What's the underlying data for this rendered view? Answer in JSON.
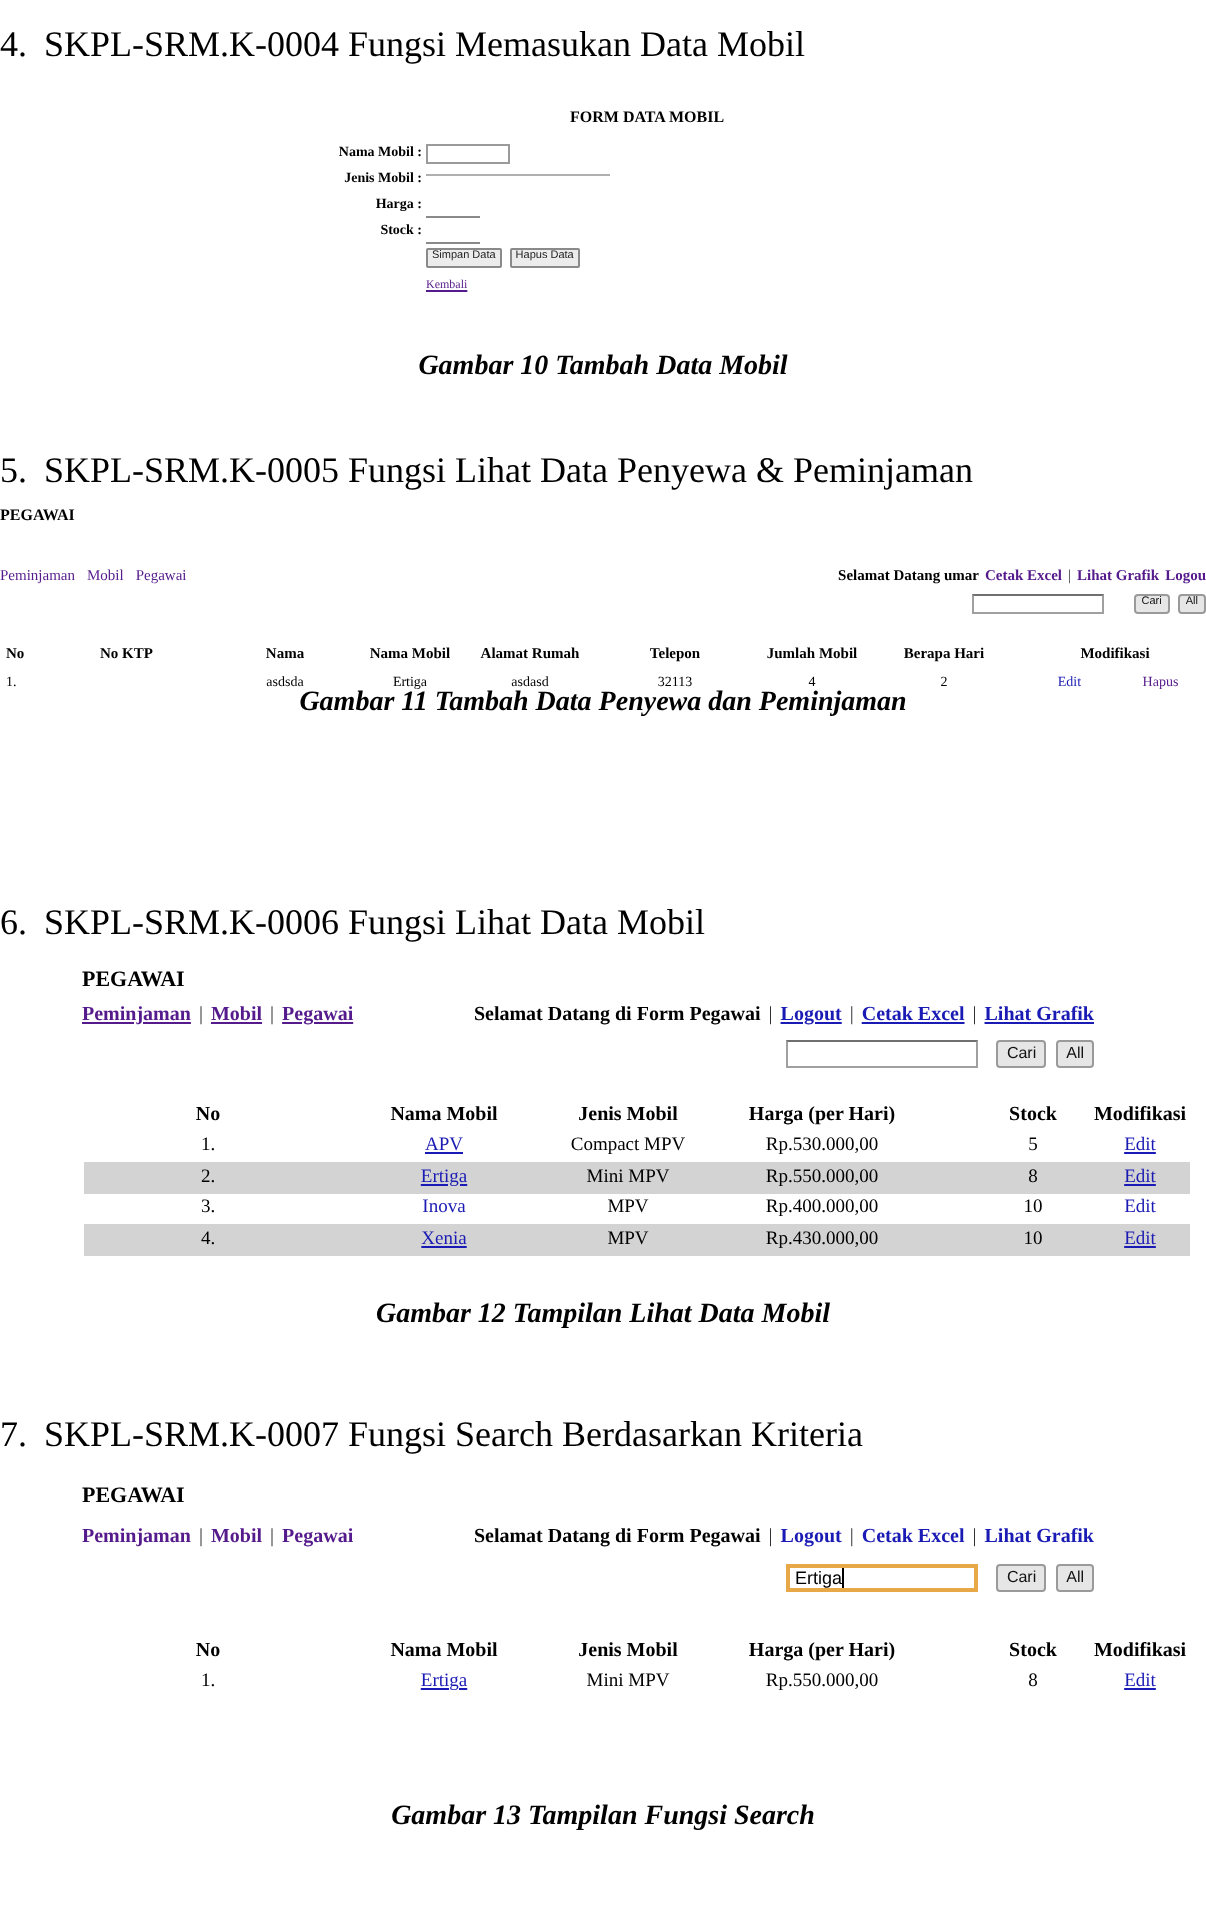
{
  "sections": [
    {
      "number": "4.",
      "title": "SKPL-SRM.K-0004 Fungsi Memasukan Data Mobil",
      "figure": {
        "kind": "form",
        "title": "FORM DATA MOBIL",
        "fields": [
          {
            "label": "Nama Mobil :",
            "kind": "box"
          },
          {
            "label": "Jenis Mobil :",
            "kind": "wide_line"
          },
          {
            "label": "Harga :",
            "kind": "short_line"
          },
          {
            "label": "Stock :",
            "kind": "short_line"
          }
        ],
        "buttons": [
          "Simpan Data",
          "Hapus Data"
        ],
        "link": {
          "text": "Kembali",
          "visited": true,
          "underlined": true
        }
      },
      "caption": "Gambar 10 Tambah Data Mobil"
    },
    {
      "number": "5.",
      "title": "SKPL-SRM.K-0005 Fungsi Lihat Data Penyewa & Peminjaman",
      "figure": {
        "kind": "listing",
        "title": "PEGAWAI",
        "nav": [
          {
            "kind": "link",
            "text": "Peminjaman",
            "visited": true,
            "underlined": false
          },
          {
            "kind": "link",
            "text": "Mobil",
            "visited": true,
            "underlined": false
          },
          {
            "kind": "link",
            "text": "Pegawai",
            "visited": true,
            "underlined": false
          }
        ],
        "header": [
          {
            "kind": "text",
            "text": "Selamat Datang umar"
          },
          {
            "kind": "link",
            "text": "Cetak Excel",
            "visited": true,
            "underlined": false
          },
          {
            "kind": "separator",
            "text": "|"
          },
          {
            "kind": "link",
            "text": "Lihat Grafik",
            "visited": true,
            "underlined": false
          },
          {
            "kind": "link",
            "text": "Logou",
            "visited": true,
            "underlined": false
          }
        ],
        "search": {
          "focused": false
        },
        "search_buttons": [
          "Cari",
          "All"
        ],
        "table": {
          "columns": [
            "No",
            "No KTP",
            "Nama",
            "Nama Mobil",
            "Alamat Rumah",
            "Telepon",
            "Jumlah Mobil",
            "Berapa Hari",
            "Modifikasi"
          ],
          "rows": [
            {
              "cells": [
                {
                  "kind": "text",
                  "text": "1."
                },
                {
                  "kind": "blank"
                },
                {
                  "kind": "text",
                  "text": "asdsda"
                },
                {
                  "kind": "text",
                  "text": "Ertiga"
                },
                {
                  "kind": "text",
                  "text": "asdasd"
                },
                {
                  "kind": "text",
                  "text": "32113"
                },
                {
                  "kind": "text",
                  "text": "4"
                },
                {
                  "kind": "text",
                  "text": "2"
                },
                {
                  "kind": "links",
                  "links": [
                    {
                      "text": "Edit",
                      "visited": false,
                      "underlined": false
                    },
                    {
                      "text": "Hapus",
                      "visited": true,
                      "underlined": false
                    }
                  ]
                }
              ]
            }
          ]
        }
      },
      "caption": "Gambar 11 Tambah Data Penyewa dan Peminjaman"
    },
    {
      "number": "6.",
      "title": "SKPL-SRM.K-0006 Fungsi Lihat Data Mobil",
      "figure": {
        "kind": "listing",
        "title": "PEGAWAI",
        "nav": [
          {
            "kind": "link",
            "text": "Peminjaman",
            "visited": true,
            "underlined": true
          },
          {
            "kind": "separator",
            "text": "|"
          },
          {
            "kind": "link",
            "text": "Mobil",
            "visited": true,
            "underlined": true
          },
          {
            "kind": "separator",
            "text": "|"
          },
          {
            "kind": "link",
            "text": "Pegawai",
            "visited": true,
            "underlined": true
          }
        ],
        "header": [
          {
            "kind": "text",
            "text": "Selamat Datang di Form Pegawai"
          },
          {
            "kind": "separator",
            "text": "|"
          },
          {
            "kind": "link",
            "text": "Logout",
            "visited": false,
            "underlined": true
          },
          {
            "kind": "separator",
            "text": "|"
          },
          {
            "kind": "link",
            "text": "Cetak Excel",
            "visited": false,
            "underlined": true
          },
          {
            "kind": "separator",
            "text": "|"
          },
          {
            "kind": "link",
            "text": "Lihat Grafik",
            "visited": false,
            "underlined": true
          }
        ],
        "search": {
          "focused": false
        },
        "search_buttons": [
          "Cari",
          "All"
        ],
        "table": {
          "columns": [
            "No",
            "Nama Mobil",
            "Jenis Mobil",
            "Harga (per Hari)",
            "Stock",
            "Modifikasi"
          ],
          "rows": [
            {
              "shaded": false,
              "cells": [
                {
                  "kind": "text",
                  "text": "1."
                },
                {
                  "kind": "link",
                  "text": "APV",
                  "visited": false,
                  "underlined": true
                },
                {
                  "kind": "text",
                  "text": "Compact MPV"
                },
                {
                  "kind": "text",
                  "text": "Rp.530.000,00"
                },
                {
                  "kind": "text",
                  "text": "5"
                },
                {
                  "kind": "link",
                  "text": "Edit",
                  "visited": false,
                  "underlined": true
                }
              ]
            },
            {
              "shaded": true,
              "cells": [
                {
                  "kind": "text",
                  "text": "2."
                },
                {
                  "kind": "link",
                  "text": "Ertiga",
                  "visited": false,
                  "underlined": true
                },
                {
                  "kind": "text",
                  "text": "Mini MPV"
                },
                {
                  "kind": "text",
                  "text": "Rp.550.000,00"
                },
                {
                  "kind": "text",
                  "text": "8"
                },
                {
                  "kind": "link",
                  "text": "Edit",
                  "visited": false,
                  "underlined": true
                }
              ]
            },
            {
              "shaded": false,
              "cells": [
                {
                  "kind": "text",
                  "text": "3."
                },
                {
                  "kind": "link",
                  "text": "Inova",
                  "visited": false,
                  "underlined": false
                },
                {
                  "kind": "text",
                  "text": "MPV"
                },
                {
                  "kind": "text",
                  "text": "Rp.400.000,00"
                },
                {
                  "kind": "text",
                  "text": "10"
                },
                {
                  "kind": "link",
                  "text": "Edit",
                  "visited": false,
                  "underlined": false
                }
              ]
            },
            {
              "shaded": true,
              "cells": [
                {
                  "kind": "text",
                  "text": "4."
                },
                {
                  "kind": "link",
                  "text": "Xenia",
                  "visited": false,
                  "underlined": true
                },
                {
                  "kind": "text",
                  "text": "MPV"
                },
                {
                  "kind": "text",
                  "text": "Rp.430.000,00"
                },
                {
                  "kind": "text",
                  "text": "10"
                },
                {
                  "kind": "link",
                  "text": "Edit",
                  "visited": false,
                  "underlined": true
                }
              ]
            }
          ]
        }
      },
      "caption": "Gambar 12 Tampilan Lihat Data Mobil"
    },
    {
      "number": "7.",
      "title": "SKPL-SRM.K-0007 Fungsi Search Berdasarkan Kriteria",
      "figure": {
        "kind": "listing",
        "title": "PEGAWAI",
        "nav": [
          {
            "kind": "link",
            "text": "Peminjaman",
            "visited": true,
            "underlined": false
          },
          {
            "kind": "separator",
            "text": "|"
          },
          {
            "kind": "link",
            "text": "Mobil",
            "visited": true,
            "underlined": false
          },
          {
            "kind": "separator",
            "text": "|"
          },
          {
            "kind": "link",
            "text": "Pegawai",
            "visited": true,
            "underlined": false
          }
        ],
        "header": [
          {
            "kind": "text",
            "text": "Selamat Datang di Form Pegawai"
          },
          {
            "kind": "separator",
            "text": "|"
          },
          {
            "kind": "link",
            "text": "Logout",
            "visited": false,
            "underlined": false
          },
          {
            "kind": "separator",
            "text": "|"
          },
          {
            "kind": "link",
            "text": "Cetak Excel",
            "visited": false,
            "underlined": false
          },
          {
            "kind": "separator",
            "text": "|"
          },
          {
            "kind": "link",
            "text": "Lihat Grafik",
            "visited": false,
            "underlined": false
          }
        ],
        "search": {
          "focused": true,
          "value": "Ertiga"
        },
        "search_buttons": [
          "Cari",
          "All"
        ],
        "table": {
          "columns": [
            "No",
            "Nama Mobil",
            "Jenis Mobil",
            "Harga (per Hari)",
            "Stock",
            "Modifikasi"
          ],
          "rows": [
            {
              "cells": [
                {
                  "kind": "text",
                  "text": "1."
                },
                {
                  "kind": "link",
                  "text": "Ertiga",
                  "visited": false,
                  "underlined": true
                },
                {
                  "kind": "text",
                  "text": "Mini MPV"
                },
                {
                  "kind": "text",
                  "text": "Rp.550.000,00"
                },
                {
                  "kind": "text",
                  "text": "8"
                },
                {
                  "kind": "link",
                  "text": "Edit",
                  "visited": false,
                  "underlined": true
                }
              ]
            }
          ]
        }
      },
      "caption": "Gambar 13 Tampilan Fungsi Search"
    }
  ]
}
